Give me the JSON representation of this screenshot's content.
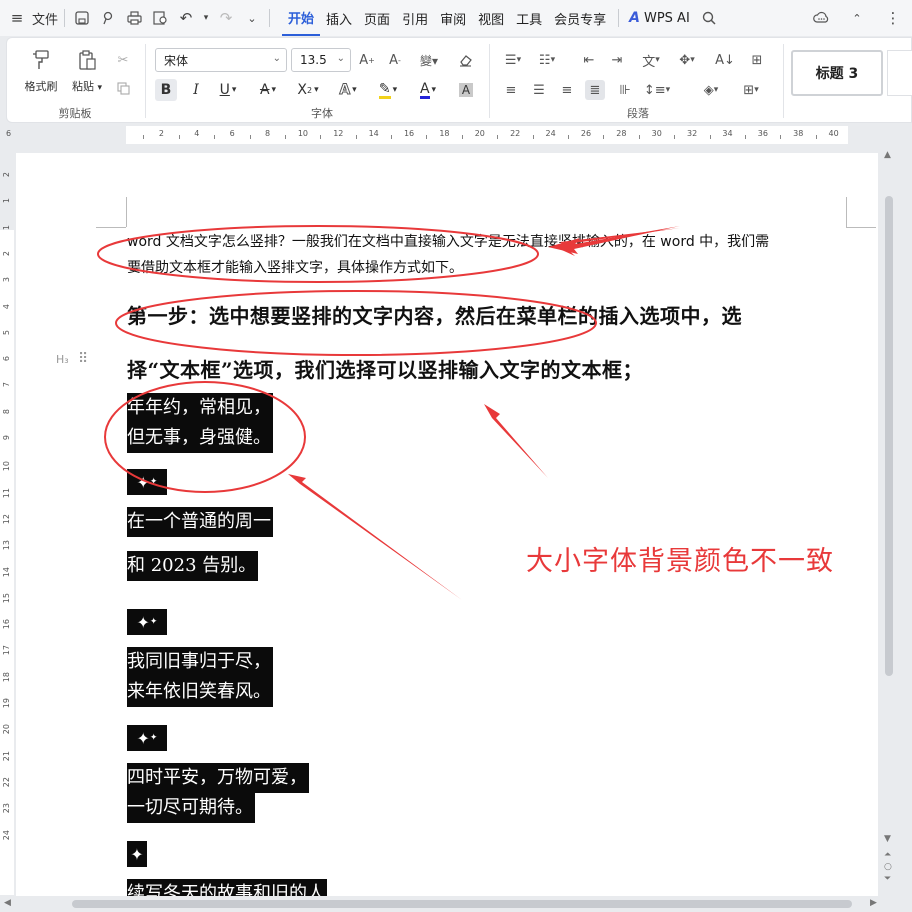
{
  "menubar": {
    "file_label": "文件",
    "tabs": [
      "开始",
      "插入",
      "页面",
      "引用",
      "审阅",
      "视图",
      "工具",
      "会员专享"
    ],
    "active_tab": "开始",
    "ai_label": "WPS AI"
  },
  "ribbon": {
    "clipboard": {
      "format_painter": "格式刷",
      "paste": "粘贴",
      "group_label": "剪贴板"
    },
    "font": {
      "font_name": "宋体",
      "font_size": "13.5",
      "group_label": "字体"
    },
    "paragraph": {
      "group_label": "段落"
    },
    "styles": {
      "heading3": "标题 3"
    }
  },
  "ruler": {
    "left_num": "6",
    "numbers": [
      "2",
      "4",
      "6",
      "8",
      "10",
      "12",
      "14",
      "16",
      "18",
      "20",
      "22",
      "24",
      "26",
      "28",
      "30",
      "32",
      "34",
      "36",
      "38",
      "40"
    ],
    "vertical_numbers": [
      "2",
      "1",
      "1",
      "2",
      "3",
      "4",
      "5",
      "6",
      "7",
      "8",
      "9",
      "10",
      "11",
      "12",
      "13",
      "14",
      "15",
      "16",
      "17",
      "18",
      "19",
      "20",
      "21",
      "22",
      "23",
      "24"
    ]
  },
  "document": {
    "intro_line1": "word 文档文字怎么竖排？一般我们在文档中直接输入文字是无法直接竖排输入的，在 word 中，我们需",
    "intro_line2": "要借助文本框才能输入竖排文字，具体操作方式如下。",
    "step_line1": "第一步：选中想要竖排的文字内容，然后在菜单栏的插入选项中，选",
    "step_line2": "择“文本框”选项，我们选择可以竖排输入文字的文本框；",
    "poem": [
      "年年约，常相见，",
      "但无事，身强健。",
      "在一个普通的周一",
      "和 2023 告别。",
      "我同旧事归于尽，",
      "来年依旧笑春风。",
      "四时平安，万物可爱，",
      "一切尽可期待。",
      "续写冬天的故事和旧的人"
    ],
    "annotation": "大小字体背景颜色不一致"
  },
  "colors": {
    "accent": "#2c5fd9",
    "annotation_red": "#e8393a",
    "highlight_bg": "#0b0b0b"
  }
}
